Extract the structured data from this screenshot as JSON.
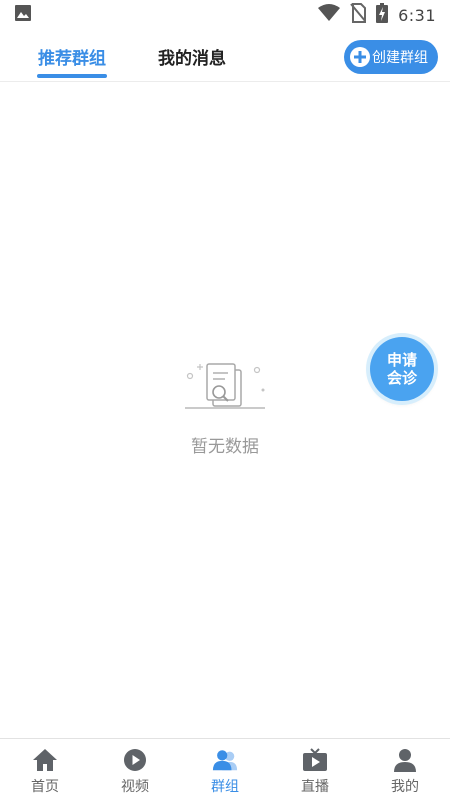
{
  "status_bar": {
    "time": "6:31",
    "icons": [
      "image-icon",
      "wifi-icon",
      "no-sim-icon",
      "battery-charging-icon"
    ]
  },
  "top_tabs": [
    {
      "label": "推荐群组",
      "active": true
    },
    {
      "label": "我的消息",
      "active": false
    }
  ],
  "create_button": {
    "label": "创建群组",
    "icon": "plus-circle-icon"
  },
  "empty_state": {
    "text": "暂无数据",
    "icon": "empty-document-search-icon"
  },
  "float_button": {
    "line1": "申请",
    "line2": "会诊"
  },
  "bottom_nav": [
    {
      "label": "首页",
      "icon": "home-icon",
      "active": false
    },
    {
      "label": "视频",
      "icon": "play-circle-icon",
      "active": false
    },
    {
      "label": "群组",
      "icon": "group-icon",
      "active": true
    },
    {
      "label": "直播",
      "icon": "tv-play-icon",
      "active": false
    },
    {
      "label": "我的",
      "icon": "person-icon",
      "active": false
    }
  ],
  "colors": {
    "accent": "#3a8ee6",
    "inactive": "#666666",
    "empty_text": "#999999"
  }
}
